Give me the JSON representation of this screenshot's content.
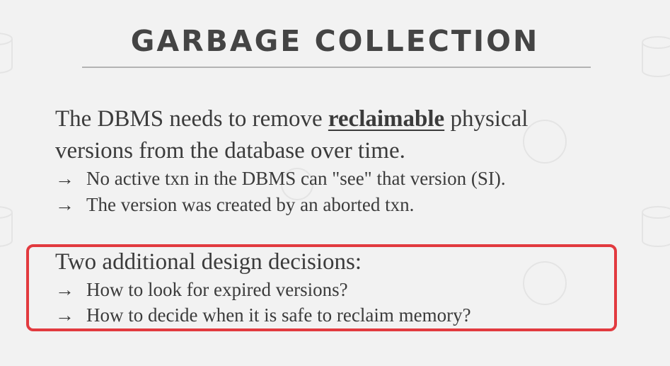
{
  "slide": {
    "title": "GARBAGE COLLECTION",
    "intro": {
      "part1": "The DBMS needs to remove ",
      "emphasis": "reclaimable",
      "part2": " physical",
      "line2": "versions from the database over time."
    },
    "bullets": [
      "No active txn in the DBMS can \"see\" that version (SI).",
      "The version was created by an aborted txn."
    ],
    "design": {
      "heading": "Two additional design decisions:",
      "bullets": [
        "How to look for expired versions?",
        "How to decide when it is safe to reclaim memory?"
      ]
    },
    "arrow_glyph": "→",
    "highlight_color": "#e23a3f"
  }
}
